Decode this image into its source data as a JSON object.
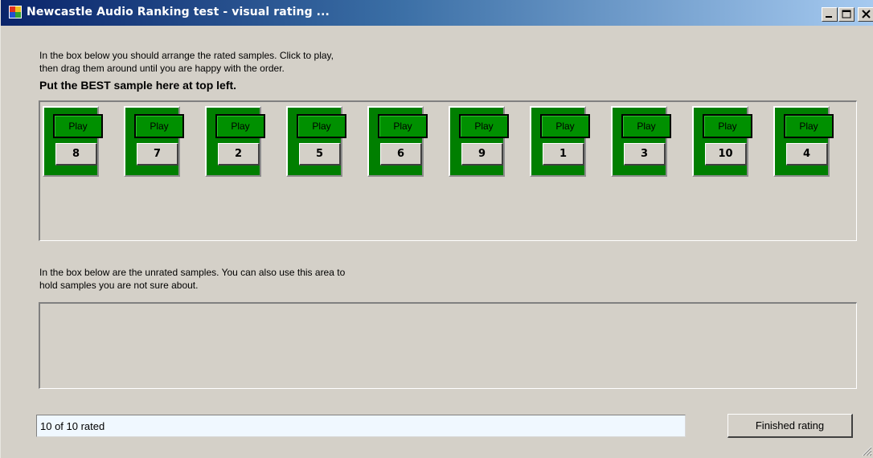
{
  "window": {
    "title": "Newcastle Audio Ranking test - visual rating ...",
    "icon": "app-icon",
    "controls": [
      "minimize-icon",
      "maximize-icon",
      "close-icon"
    ]
  },
  "instructions": {
    "line1": "In the box below you should arrange the rated samples. Click to play,",
    "line2": "then drag them around until you are happy with the order.",
    "best_label": "Put the BEST sample here at top left."
  },
  "rated_samples": [
    {
      "play_label": "Play",
      "rank": "8"
    },
    {
      "play_label": "Play",
      "rank": "7"
    },
    {
      "play_label": "Play",
      "rank": "2"
    },
    {
      "play_label": "Play",
      "rank": "5"
    },
    {
      "play_label": "Play",
      "rank": "6"
    },
    {
      "play_label": "Play",
      "rank": "9"
    },
    {
      "play_label": "Play",
      "rank": "1"
    },
    {
      "play_label": "Play",
      "rank": "3"
    },
    {
      "play_label": "Play",
      "rank": "10"
    },
    {
      "play_label": "Play",
      "rank": "4"
    }
  ],
  "unrated": {
    "line1": "In the box below are the unrated samples. You can also use this area to",
    "line2": "hold samples you are not sure about."
  },
  "status": {
    "progress_text": "10 of 10 rated"
  },
  "finish_button": {
    "label": "Finished rating"
  },
  "colors": {
    "tile_green": "#007f00",
    "play_green": "#009000",
    "window_bg": "#d4d0c8",
    "titlebar_start": "#0a246a"
  }
}
